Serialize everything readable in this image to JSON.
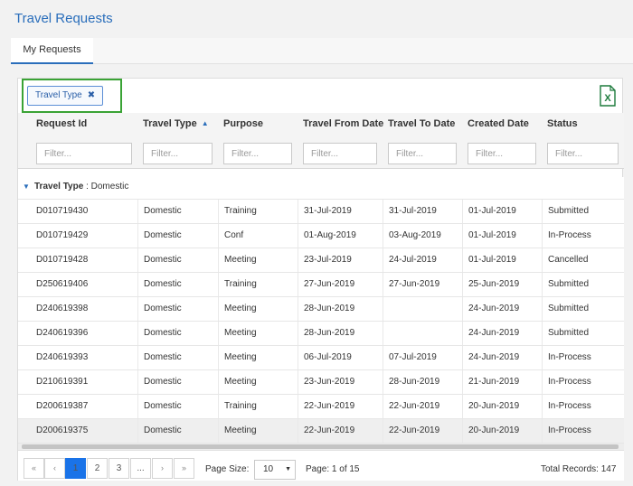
{
  "title": "Travel Requests",
  "tabs": [
    {
      "label": "My Requests",
      "active": true
    }
  ],
  "grouping": {
    "chip_label": "Travel Type",
    "close_icon": "✖"
  },
  "export": {
    "icon": "excel-export-icon",
    "glyph": "X"
  },
  "columns": [
    {
      "label": "Request Id",
      "sort": "",
      "placeholder": "Filter..."
    },
    {
      "label": "Travel Type",
      "sort": "asc",
      "placeholder": "Filter..."
    },
    {
      "label": "Purpose",
      "sort": "",
      "placeholder": "Filter..."
    },
    {
      "label": "Travel From Date",
      "sort": "",
      "placeholder": "Filter..."
    },
    {
      "label": "Travel To Date",
      "sort": "",
      "placeholder": "Filter..."
    },
    {
      "label": "Created Date",
      "sort": "",
      "placeholder": "Filter..."
    },
    {
      "label": "Status",
      "sort": "",
      "placeholder": "Filter..."
    }
  ],
  "group": {
    "field": "Travel Type",
    "separator": ":",
    "value": "Domestic"
  },
  "rows": [
    [
      "D010719430",
      "Domestic",
      "Training",
      "31-Jul-2019",
      "31-Jul-2019",
      "01-Jul-2019",
      "Submitted"
    ],
    [
      "D010719429",
      "Domestic",
      "Conf",
      "01-Aug-2019",
      "03-Aug-2019",
      "01-Jul-2019",
      "In-Process"
    ],
    [
      "D010719428",
      "Domestic",
      "Meeting",
      "23-Jul-2019",
      "24-Jul-2019",
      "01-Jul-2019",
      "Cancelled"
    ],
    [
      "D250619406",
      "Domestic",
      "Training",
      "27-Jun-2019",
      "27-Jun-2019",
      "25-Jun-2019",
      "Submitted"
    ],
    [
      "D240619398",
      "Domestic",
      "Meeting",
      "28-Jun-2019",
      "",
      "24-Jun-2019",
      "Submitted"
    ],
    [
      "D240619396",
      "Domestic",
      "Meeting",
      "28-Jun-2019",
      "",
      "24-Jun-2019",
      "Submitted"
    ],
    [
      "D240619393",
      "Domestic",
      "Meeting",
      "06-Jul-2019",
      "07-Jul-2019",
      "24-Jun-2019",
      "In-Process"
    ],
    [
      "D210619391",
      "Domestic",
      "Meeting",
      "23-Jun-2019",
      "28-Jun-2019",
      "21-Jun-2019",
      "In-Process"
    ],
    [
      "D200619387",
      "Domestic",
      "Training",
      "22-Jun-2019",
      "22-Jun-2019",
      "20-Jun-2019",
      "In-Process"
    ],
    [
      "D200619375",
      "Domestic",
      "Meeting",
      "22-Jun-2019",
      "22-Jun-2019",
      "20-Jun-2019",
      "In-Process"
    ]
  ],
  "selected_row": 9,
  "pager": {
    "first": "«",
    "prev": "‹",
    "next": "›",
    "last": "»",
    "pages": [
      "1",
      "2",
      "3",
      "..."
    ],
    "current_page": 1,
    "page_size_label": "Page Size:",
    "page_size": "10",
    "page_info": "Page: 1 of 15",
    "total_records": "Total Records: 147"
  },
  "colors": {
    "accent": "#2a6ebb",
    "active_page": "#1a73e8",
    "group_highlight": "#3aa335",
    "excel": "#1d7a3c"
  }
}
